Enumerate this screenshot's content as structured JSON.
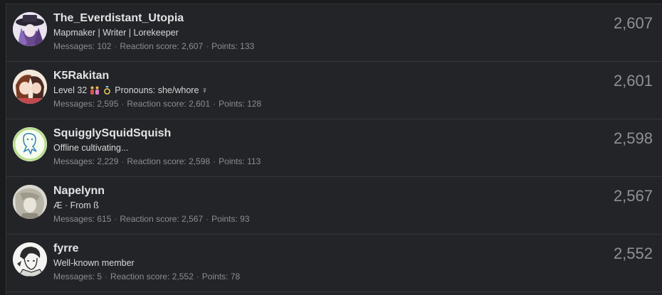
{
  "members": [
    {
      "username": "The_Everdistant_Utopia",
      "title": "Mapmaker | Writer | Lorekeeper",
      "messages_label": "Messages: 102",
      "reaction_label": "Reaction score: 2,607",
      "points_label": "Points: 133",
      "score": "2,607"
    },
    {
      "username": "K5Rakitan",
      "title_pre": "Level 32",
      "title_post": "Pronouns: she/whore ♀",
      "messages_label": "Messages: 2,595",
      "reaction_label": "Reaction score: 2,601",
      "points_label": "Points: 128",
      "score": "2,601"
    },
    {
      "username": "SquigglySquidSquish",
      "title": "Offline cultivating...",
      "messages_label": "Messages: 2,229",
      "reaction_label": "Reaction score: 2,598",
      "points_label": "Points: 113",
      "score": "2,598"
    },
    {
      "username": "Napelynn",
      "title": "Æ · From ß",
      "messages_label": "Messages: 615",
      "reaction_label": "Reaction score: 2,567",
      "points_label": "Points: 93",
      "score": "2,567"
    },
    {
      "username": "fyrre",
      "title": "Well-known member",
      "messages_label": "Messages: 5",
      "reaction_label": "Reaction score: 2,552",
      "points_label": "Points: 78",
      "score": "2,552"
    }
  ],
  "separator": "·",
  "icons": {
    "family_emoji": "family-icon",
    "ring_emoji": "ring-icon"
  }
}
